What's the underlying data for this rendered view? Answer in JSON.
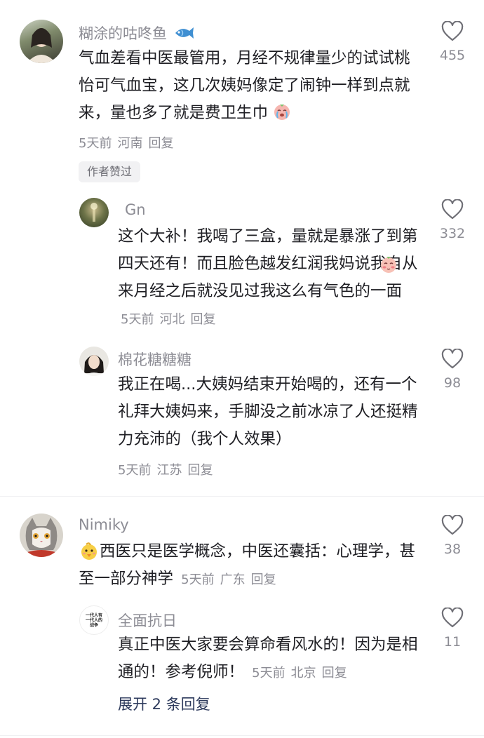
{
  "comments": [
    {
      "username": "糊涂的咕咚鱼",
      "text": "气血差看中医最管用，月经不规律量少的试试桃怡可气血宝，这几次姨妈像定了闹钟一样到点就来，量也多了就是费卫生巾",
      "time": "5天前",
      "location": "河南",
      "reply": "回复",
      "likes": "455",
      "badge": "作者赞过",
      "replies": [
        {
          "username": "Gn",
          "text": "这个大补！我喝了三盒，量就是暴涨了到第四天还有！而且脸色越发红润我妈说我自从来月经之后就没见过我这么有气色的一面",
          "time": "5天前",
          "location": "河北",
          "reply": "回复",
          "likes": "332"
        },
        {
          "username": "棉花糖糖糖",
          "text": "我正在喝...大姨妈结束开始喝的，还有一个礼拜大姨妈来，手脚没之前冰凉了人还挺精力充沛的（我个人效果）",
          "time": "5天前",
          "location": "江苏",
          "reply": "回复",
          "likes": "98"
        }
      ]
    },
    {
      "username": "Nimiky",
      "text": "西医只是医学概念，中医还囊括：心理学，甚至一部分神学",
      "time": "5天前",
      "location": "广东",
      "reply": "回复",
      "likes": "38",
      "replies": [
        {
          "username": "全面抗日",
          "avatar_text": "一代人有一代人的战争",
          "text": "真正中医大家要会算命看风水的！因为是相通的！参考倪师！",
          "time": "5天前",
          "location": "北京",
          "reply": "回复",
          "likes": "11"
        }
      ],
      "expand": "展开 2 条回复"
    }
  ],
  "icons": {
    "like": "heart-outline-icon",
    "fish": "fish-emoji-icon",
    "cry": "crying-face-emoji-icon",
    "blush": "blushing-face-emoji-icon",
    "chick": "chick-face-emoji-icon"
  },
  "colors": {
    "text": "#1e1e23",
    "secondary": "#8c8c94",
    "expand": "#2d3a5c",
    "badge_bg": "#f1f1f3"
  }
}
